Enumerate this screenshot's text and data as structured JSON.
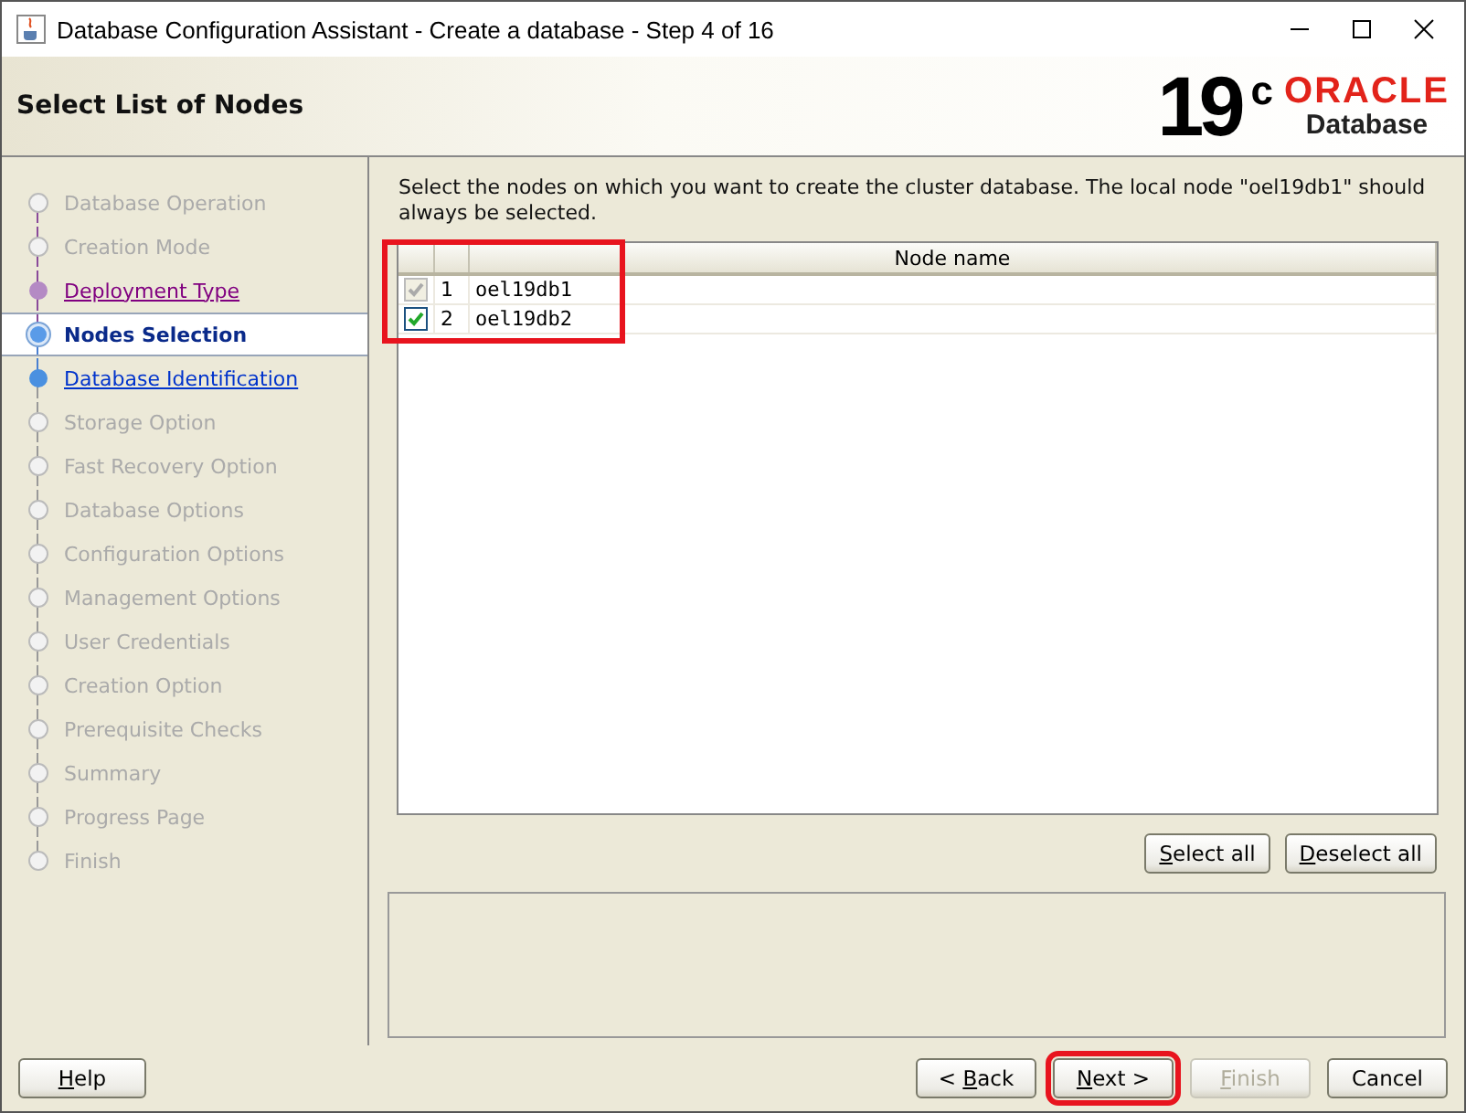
{
  "window": {
    "title": "Database Configuration Assistant - Create a database - Step 4 of 16"
  },
  "header": {
    "title": "Select List of Nodes",
    "logo": {
      "version": "19",
      "superscript": "c",
      "brand": "ORACLE",
      "product": "Database"
    }
  },
  "steps": [
    {
      "label": "Database Operation",
      "kind": "pending"
    },
    {
      "label": "Creation Mode",
      "kind": "pending"
    },
    {
      "label": "Deployment Type",
      "kind": "visited"
    },
    {
      "label": "Nodes Selection",
      "kind": "current"
    },
    {
      "label": "Database Identification",
      "kind": "link"
    },
    {
      "label": "Storage Option",
      "kind": "pending"
    },
    {
      "label": "Fast Recovery Option",
      "kind": "pending"
    },
    {
      "label": "Database Options",
      "kind": "pending"
    },
    {
      "label": "Configuration Options",
      "kind": "pending"
    },
    {
      "label": "Management Options",
      "kind": "pending"
    },
    {
      "label": "User Credentials",
      "kind": "pending"
    },
    {
      "label": "Creation Option",
      "kind": "pending"
    },
    {
      "label": "Prerequisite Checks",
      "kind": "pending"
    },
    {
      "label": "Summary",
      "kind": "pending"
    },
    {
      "label": "Progress Page",
      "kind": "pending"
    },
    {
      "label": "Finish",
      "kind": "pending"
    }
  ],
  "instruction": "Select the nodes on which you want to create the cluster database. The local node \"oel19db1\" should always be selected.",
  "table": {
    "highlighted": true,
    "columns": [
      "Node name"
    ],
    "rows": [
      {
        "number": "1",
        "node": "oel19db1",
        "checked": true,
        "disabled": true
      },
      {
        "number": "2",
        "node": "oel19db2",
        "checked": true,
        "disabled": false
      }
    ]
  },
  "table_buttons": [
    {
      "key": "S",
      "post": "elect all"
    },
    {
      "key": "D",
      "post": "eselect all"
    }
  ],
  "footer": {
    "help": {
      "key": "H",
      "post": "elp",
      "disabled": false
    },
    "nav": [
      {
        "pre": "< ",
        "key": "B",
        "post": "ack",
        "disabled": false,
        "highlighted": false
      },
      {
        "key": "N",
        "post": "ext >",
        "disabled": false,
        "highlighted": true
      },
      {
        "key": "F",
        "post": "inish",
        "disabled": true,
        "highlighted": false
      },
      {
        "post": "Cancel",
        "disabled": false,
        "highlighted": false
      }
    ]
  }
}
